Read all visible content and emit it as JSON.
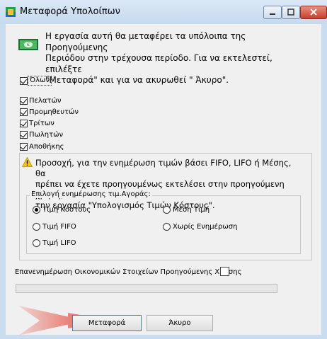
{
  "window": {
    "title": "Μεταφορά Υπολοίπων",
    "info_icon": "transfer-money-icon",
    "info_lines": [
      "Η εργασία αυτή θα μεταφέρει τα υπόλοιπα της Προηγούμενης",
      "Περιόδου στην τρέχουσα περίοδο. Για να εκτελεστεί,  επιλέξτε",
      "\"Μεταφορά\" και για να ακυρωθεί \" Άκυρο\"."
    ]
  },
  "checkboxes": {
    "all": {
      "label": "Όλων",
      "checked": true
    },
    "items": [
      {
        "label": "Πελατών",
        "checked": true
      },
      {
        "label": "Προμηθευτών",
        "checked": true
      },
      {
        "label": "Τρίτων",
        "checked": true
      },
      {
        "label": "Πωλητών",
        "checked": true
      },
      {
        "label": "Αποθήκης",
        "checked": true
      }
    ]
  },
  "warning": {
    "icon": "warning-icon",
    "lines": [
      "Προσοχή, για την ενημέρωση τιμών βάσει FIFO, LIFO ή Μέσης, θα",
      "πρέπει να έχετε προηγουμένως εκτελέσει στην προηγούμενη χρήση,",
      "την εργασία \"Υπολογισμός Τιμών Κόστους\"."
    ]
  },
  "price_update": {
    "title": "Επιλογή ενημέρωσης τιμ.Αγοράς:",
    "options": [
      {
        "label": "Τιμή Κόστους",
        "selected": true
      },
      {
        "label": "Μέση Τιμή",
        "selected": false
      },
      {
        "label": "Τιμή FIFO",
        "selected": false
      },
      {
        "label": "Χωρίς Ενημέρωση",
        "selected": false
      },
      {
        "label": "Τιμή LIFO",
        "selected": false
      }
    ]
  },
  "recalc": {
    "label": "Επανενημέρωση Οικονομικών Στοιχείων Προηγούμενης Χρήσης",
    "checked": false
  },
  "progress": {
    "value": 0
  },
  "buttons": {
    "transfer": "Μεταφορά",
    "cancel": "Άκυρο"
  },
  "colors": {
    "progress_fill": "#06b025",
    "arrow": "#e53b2c",
    "titlebar": "#c9dcf0"
  }
}
